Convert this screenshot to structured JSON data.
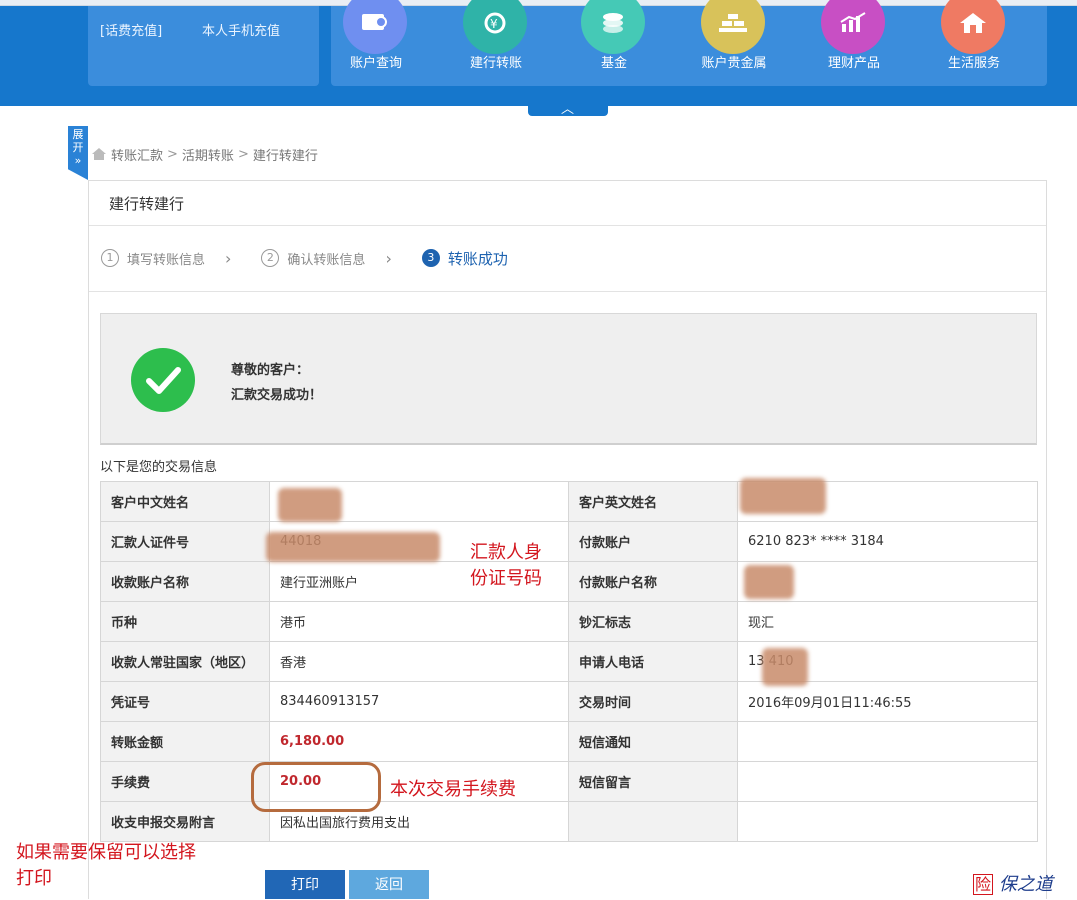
{
  "header": {
    "left_links": [
      "[话费充值]",
      "本人手机充值"
    ],
    "nav": [
      {
        "label": "账户查询",
        "icon": "account-query-icon",
        "color": "#6f8ff0"
      },
      {
        "label": "建行转账",
        "icon": "transfer-icon",
        "color": "#2fb3a8"
      },
      {
        "label": "基金",
        "icon": "fund-icon",
        "color": "#45c9b6"
      },
      {
        "label": "账户贵金属",
        "icon": "precious-metal-icon",
        "color": "#d8c25a"
      },
      {
        "label": "理财产品",
        "icon": "wealth-product-icon",
        "color": "#c84fc4"
      },
      {
        "label": "生活服务",
        "icon": "life-service-icon",
        "color": "#ef7a63"
      }
    ],
    "collapse_glyph": "︿"
  },
  "side_tab": {
    "label": "展开",
    "glyph": "»"
  },
  "breadcrumb": {
    "items": [
      "转账汇款",
      "活期转账",
      "建行转建行"
    ],
    "sep": ">"
  },
  "panel": {
    "title": "建行转建行"
  },
  "steps": [
    {
      "num": "1",
      "label": "填写转账信息",
      "active": false
    },
    {
      "num": "2",
      "label": "确认转账信息",
      "active": false
    },
    {
      "num": "3",
      "label": "转账成功",
      "active": true
    }
  ],
  "success": {
    "line1": "尊敬的客户：",
    "line2": "汇款交易成功！"
  },
  "info_intro": "以下是您的交易信息",
  "table": {
    "rows": [
      [
        {
          "label": "客户中文姓名",
          "value": ""
        },
        {
          "label": "客户英文姓名",
          "value": ""
        }
      ],
      [
        {
          "label": "汇款人证件号",
          "value": "44018"
        },
        {
          "label": "付款账户",
          "value": "6210 823* **** 3184"
        }
      ],
      [
        {
          "label": "收款账户名称",
          "value": "建行亚洲账户"
        },
        {
          "label": "付款账户名称",
          "value": ""
        }
      ],
      [
        {
          "label": "币种",
          "value": "港币"
        },
        {
          "label": "钞汇标志",
          "value": "现汇"
        }
      ],
      [
        {
          "label": "收款人常驻国家（地区）",
          "value": "香港"
        },
        {
          "label": "申请人电话",
          "value": "13       410"
        }
      ],
      [
        {
          "label": "凭证号",
          "value": "834460913157"
        },
        {
          "label": "交易时间",
          "value": "2016年09月01日11:46:55"
        }
      ],
      [
        {
          "label": "转账金额",
          "value": "6,180.00",
          "red": true
        },
        {
          "label": "短信通知",
          "value": ""
        }
      ],
      [
        {
          "label": "手续费",
          "value": "20.00",
          "red": true
        },
        {
          "label": "短信留言",
          "value": ""
        }
      ],
      [
        {
          "label": "收支申报交易附言",
          "value": "因私出国旅行费用支出"
        },
        {
          "label": "",
          "value": ""
        }
      ]
    ]
  },
  "annotations": {
    "id_note": [
      "汇款人身",
      "份证号码"
    ],
    "fee_note": "本次交易手续费",
    "print_note": [
      "如果需要保留可以选择",
      "打印"
    ]
  },
  "buttons": {
    "print": "打印",
    "back": "返回"
  },
  "watermark": {
    "seal": "险",
    "text": "保之道"
  }
}
